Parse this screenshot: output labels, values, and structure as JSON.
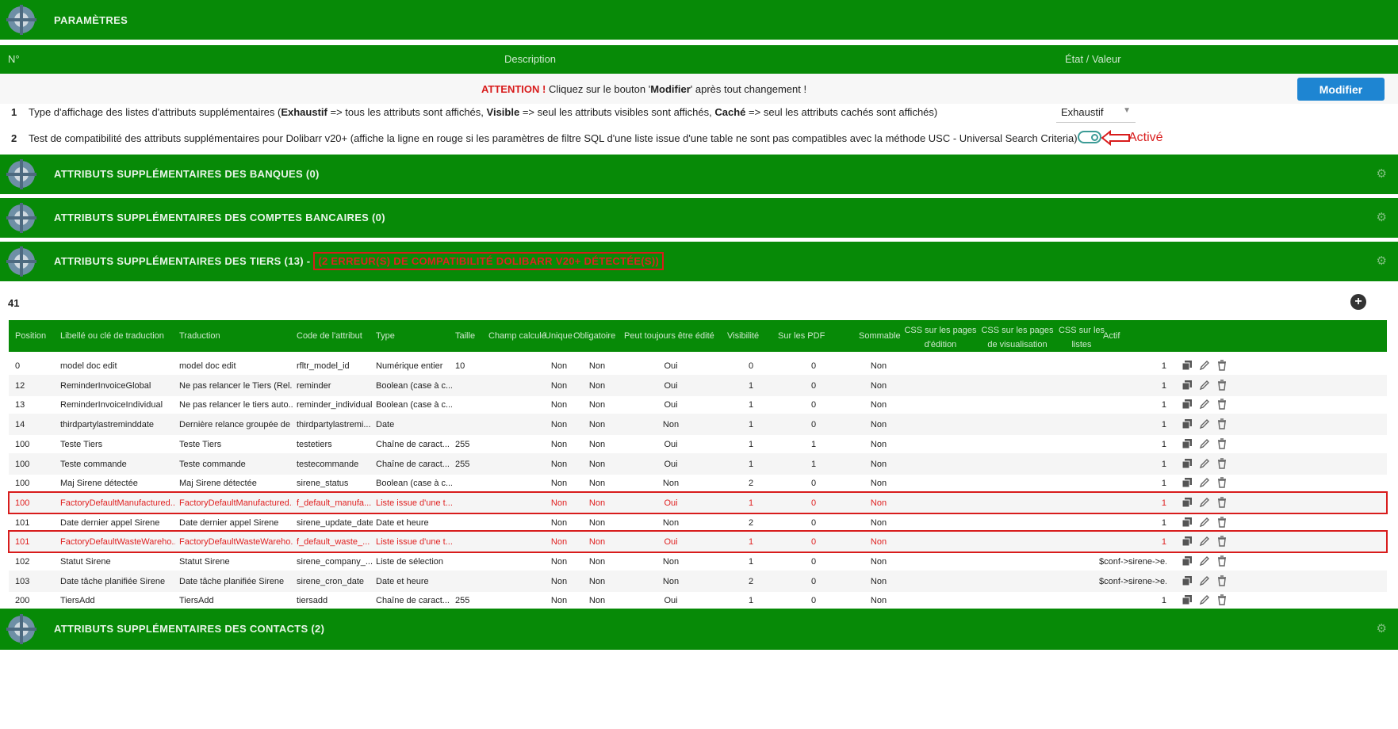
{
  "sections": {
    "params_title": "PARAMÈTRES",
    "banks": "ATTRIBUTS SUPPLÉMENTAIRES DES BANQUES (0)",
    "bank_accounts": "ATTRIBUTS SUPPLÉMENTAIRES DES COMPTES BANCAIRES (0)",
    "thirdparties": "ATTRIBUTS SUPPLÉMENTAIRES DES TIERS (13) -",
    "thirdparties_error": "(2 ERREUR(S) DE COMPATIBILITÉ DOLIBARR V20+ DÉTECTÉE(S))",
    "contacts": "ATTRIBUTS SUPPLÉMENTAIRES DES CONTACTS (2)"
  },
  "params_header": {
    "num": "N°",
    "description": "Description",
    "value": "État / Valeur"
  },
  "attention": {
    "prefix": "ATTENTION !",
    "text1": "Cliquez sur le bouton '",
    "bold": "Modifier",
    "text2": "' après tout changement !"
  },
  "modify_button": "Modifier",
  "params": [
    {
      "num": "1",
      "desc_parts": [
        "Type d'affichage des listes d'attributs supplémentaires (",
        "Exhaustif",
        " => tous les attributs sont affichés, ",
        "Visible",
        " => seul les attributs visibles sont affichés, ",
        "Caché",
        " => seul les attributs cachés sont affichés)"
      ],
      "value": "Exhaustif"
    },
    {
      "num": "2",
      "desc": "Test de compatibilité des attributs supplémentaires pour Dolibarr v20+ (affiche la ligne en rouge si les paramètres de filtre SQL d'une liste issue d'une table ne sont pas compatibles avec la méthode USC - Universal Search Criteria)",
      "value": "Activé",
      "toggle_on": true
    }
  ],
  "table": {
    "count": "41",
    "headers": [
      "Position",
      "Libellé ou clé de traduction",
      "Traduction",
      "Code de l'attribut",
      "Type",
      "Taille",
      "Champ calculé",
      "Unique",
      "Obligatoire",
      "Peut toujours être édité",
      "Visibilité",
      "Sur les PDF",
      "Sommable",
      "CSS sur les pages d'édition",
      "CSS sur les pages de visualisation",
      "CSS sur les listes",
      "Actif"
    ],
    "rows": [
      [
        "0",
        "model doc edit",
        "model doc edit",
        "rfltr_model_id",
        "Numérique entier",
        "10",
        "",
        "Non",
        "Non",
        "Oui",
        "0",
        "0",
        "Non",
        "",
        "",
        "",
        "1"
      ],
      [
        "12",
        "ReminderInvoiceGlobal",
        "Ne pas relancer le Tiers (Rel...",
        "reminder",
        "Boolean (case à c...",
        "",
        "",
        "Non",
        "Non",
        "Oui",
        "1",
        "0",
        "Non",
        "",
        "",
        "",
        "1"
      ],
      [
        "13",
        "ReminderInvoiceIndividual",
        "Ne pas relancer le tiers auto...",
        "reminder_individual",
        "Boolean (case à c...",
        "",
        "",
        "Non",
        "Non",
        "Oui",
        "1",
        "0",
        "Non",
        "",
        "",
        "",
        "1"
      ],
      [
        "14",
        "thirdpartylastreminddate",
        "Dernière relance groupée de ...",
        "thirdpartylastremi...",
        "Date",
        "",
        "",
        "Non",
        "Non",
        "Non",
        "1",
        "0",
        "Non",
        "",
        "",
        "",
        "1"
      ],
      [
        "100",
        "Teste Tiers",
        "Teste Tiers",
        "testetiers",
        "Chaîne de caract...",
        "255",
        "",
        "Non",
        "Non",
        "Oui",
        "1",
        "1",
        "Non",
        "",
        "",
        "",
        "1"
      ],
      [
        "100",
        "Teste commande",
        "Teste commande",
        "testecommande",
        "Chaîne de caract...",
        "255",
        "",
        "Non",
        "Non",
        "Oui",
        "1",
        "1",
        "Non",
        "",
        "",
        "",
        "1"
      ],
      [
        "100",
        "Maj Sirene détectée",
        "Maj Sirene détectée",
        "sirene_status",
        "Boolean (case à c...",
        "",
        "",
        "Non",
        "Non",
        "Non",
        "2",
        "0",
        "Non",
        "",
        "",
        "",
        "1"
      ],
      [
        "100",
        "FactoryDefaultManufactured...",
        "FactoryDefaultManufactured...",
        "f_default_manufa...",
        "Liste issue d'une t...",
        "",
        "",
        "Non",
        "Non",
        "Oui",
        "1",
        "0",
        "Non",
        "",
        "",
        "",
        "1"
      ],
      [
        "101",
        "Date dernier appel Sirene",
        "Date dernier appel Sirene",
        "sirene_update_date",
        "Date et heure",
        "",
        "",
        "Non",
        "Non",
        "Non",
        "2",
        "0",
        "Non",
        "",
        "",
        "",
        "1"
      ],
      [
        "101",
        "FactoryDefaultWasteWareho...",
        "FactoryDefaultWasteWareho...",
        "f_default_waste_...",
        "Liste issue d'une t...",
        "",
        "",
        "Non",
        "Non",
        "Oui",
        "1",
        "0",
        "Non",
        "",
        "",
        "",
        "1"
      ],
      [
        "102",
        "Statut Sirene",
        "Statut Sirene",
        "sirene_company_...",
        "Liste de sélection",
        "",
        "",
        "Non",
        "Non",
        "Non",
        "1",
        "0",
        "Non",
        "",
        "",
        "",
        "$conf->sirene->e..."
      ],
      [
        "103",
        "Date tâche planifiée Sirene",
        "Date tâche planifiée Sirene",
        "sirene_cron_date",
        "Date et heure",
        "",
        "",
        "Non",
        "Non",
        "Non",
        "2",
        "0",
        "Non",
        "",
        "",
        "",
        "$conf->sirene->e..."
      ],
      [
        "200",
        "TiersAdd",
        "TiersAdd",
        "tiersadd",
        "Chaîne de caract...",
        "255",
        "",
        "Non",
        "Non",
        "Oui",
        "1",
        "0",
        "Non",
        "",
        "",
        "",
        "1"
      ]
    ],
    "error_rows": [
      7,
      9
    ]
  },
  "colors": {
    "band": "#078a07",
    "error": "#d81c1c",
    "button": "#1e85d2"
  },
  "icons": [
    "module-logo-icon",
    "gear-icon",
    "add-icon",
    "clone-icon",
    "edit-icon",
    "delete-icon"
  ]
}
